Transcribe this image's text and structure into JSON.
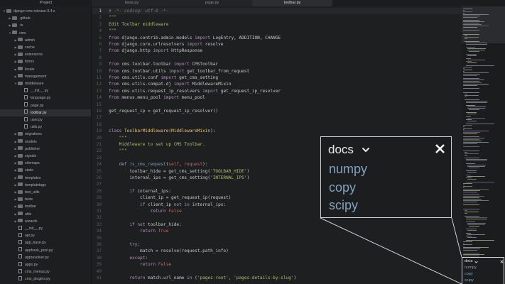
{
  "tabs": {
    "project": "Project",
    "items": [
      "base.py",
      "page.py",
      "toolbar.py"
    ]
  },
  "sidebar": {
    "rows": [
      {
        "label": "django-cms-release-3.4.x",
        "kind": "folder",
        "open": true,
        "depth": 0
      },
      {
        "label": ".github",
        "kind": "folder",
        "open": false,
        "depth": 1
      },
      {
        "label": ".tx",
        "kind": "folder",
        "open": false,
        "depth": 1
      },
      {
        "label": "cms",
        "kind": "folder",
        "open": true,
        "depth": 1
      },
      {
        "label": "admin",
        "kind": "folder",
        "open": false,
        "depth": 2
      },
      {
        "label": "cache",
        "kind": "folder",
        "open": false,
        "depth": 2
      },
      {
        "label": "extensions",
        "kind": "folder",
        "open": false,
        "depth": 2
      },
      {
        "label": "forms",
        "kind": "folder",
        "open": false,
        "depth": 2
      },
      {
        "label": "locale",
        "kind": "folder",
        "open": false,
        "depth": 2
      },
      {
        "label": "management",
        "kind": "folder",
        "open": false,
        "depth": 2
      },
      {
        "label": "middleware",
        "kind": "folder",
        "open": true,
        "depth": 2
      },
      {
        "label": "__init__.py",
        "kind": "file",
        "depth": 3
      },
      {
        "label": "language.py",
        "kind": "file",
        "depth": 3
      },
      {
        "label": "page.py",
        "kind": "file",
        "depth": 3
      },
      {
        "label": "toolbar.py",
        "kind": "file",
        "depth": 3,
        "active": true
      },
      {
        "label": "user.py",
        "kind": "file",
        "depth": 3
      },
      {
        "label": "utils.py",
        "kind": "file",
        "depth": 3
      },
      {
        "label": "migrations",
        "kind": "folder",
        "open": false,
        "depth": 2
      },
      {
        "label": "models",
        "kind": "folder",
        "open": false,
        "depth": 2
      },
      {
        "label": "publisher",
        "kind": "folder",
        "open": false,
        "depth": 2
      },
      {
        "label": "signals",
        "kind": "folder",
        "open": false,
        "depth": 2
      },
      {
        "label": "sitemaps",
        "kind": "folder",
        "open": false,
        "depth": 2
      },
      {
        "label": "static",
        "kind": "folder",
        "open": false,
        "depth": 2
      },
      {
        "label": "templates",
        "kind": "folder",
        "open": false,
        "depth": 2
      },
      {
        "label": "templatetags",
        "kind": "folder",
        "open": false,
        "depth": 2
      },
      {
        "label": "test_utils",
        "kind": "folder",
        "open": false,
        "depth": 2
      },
      {
        "label": "tests",
        "kind": "folder",
        "open": false,
        "depth": 2
      },
      {
        "label": "toolbar",
        "kind": "folder",
        "open": false,
        "depth": 2
      },
      {
        "label": "utils",
        "kind": "folder",
        "open": false,
        "depth": 2
      },
      {
        "label": "wizards",
        "kind": "folder",
        "open": false,
        "depth": 2
      },
      {
        "label": "__init__.py",
        "kind": "file",
        "depth": 2
      },
      {
        "label": "api.py",
        "kind": "file",
        "depth": 2
      },
      {
        "label": "app_base.py",
        "kind": "file",
        "depth": 2
      },
      {
        "label": "apphook_pool.py",
        "kind": "file",
        "depth": 2
      },
      {
        "label": "appresolver.py",
        "kind": "file",
        "depth": 2
      },
      {
        "label": "apps.py",
        "kind": "file",
        "depth": 2
      },
      {
        "label": "cms_menus.py",
        "kind": "file",
        "depth": 2
      },
      {
        "label": "cms_plugins.py",
        "kind": "file",
        "depth": 2
      }
    ]
  },
  "editor": {
    "current_line": 1,
    "lines": [
      [
        [
          "com",
          "# -*- coding: utf-8 -*-"
        ]
      ],
      [
        [
          "str",
          "\"\"\""
        ]
      ],
      [
        [
          "str",
          "Edit Toolbar middleware"
        ]
      ],
      [
        [
          "str",
          "\"\"\""
        ]
      ],
      [
        [
          "kw",
          "from"
        ],
        [
          "pl",
          " django.contrib.admin.models "
        ],
        [
          "kw",
          "import"
        ],
        [
          "pl",
          " LogEntry, ADDITION, CHANGE"
        ]
      ],
      [
        [
          "kw",
          "from"
        ],
        [
          "pl",
          " django.core.urlresolvers "
        ],
        [
          "kw",
          "import"
        ],
        [
          "pl",
          " resolve"
        ]
      ],
      [
        [
          "kw",
          "from"
        ],
        [
          "pl",
          " django.http "
        ],
        [
          "kw",
          "import"
        ],
        [
          "pl",
          " HttpResponse"
        ]
      ],
      [],
      [
        [
          "kw",
          "from"
        ],
        [
          "pl",
          " cms.toolbar.toolbar "
        ],
        [
          "kw",
          "import"
        ],
        [
          "pl",
          " CMSToolbar"
        ]
      ],
      [
        [
          "kw",
          "from"
        ],
        [
          "pl",
          " cms.toolbar.utils "
        ],
        [
          "kw",
          "import"
        ],
        [
          "pl",
          " get_toolbar_from_request"
        ]
      ],
      [
        [
          "kw",
          "from"
        ],
        [
          "pl",
          " cms.utils.conf "
        ],
        [
          "kw",
          "import"
        ],
        [
          "pl",
          " get_cms_setting"
        ]
      ],
      [
        [
          "kw",
          "from"
        ],
        [
          "pl",
          " cms.utils.compat.dj "
        ],
        [
          "kw",
          "import"
        ],
        [
          "pl",
          " MiddlewareMixin"
        ]
      ],
      [
        [
          "kw",
          "from"
        ],
        [
          "pl",
          " cms.utils.request_ip_resolvers "
        ],
        [
          "kw",
          "import"
        ],
        [
          "pl",
          " get_request_ip_resolver"
        ]
      ],
      [
        [
          "kw",
          "from"
        ],
        [
          "pl",
          " menus.menu_pool "
        ],
        [
          "kw",
          "import"
        ],
        [
          "pl",
          " menu_pool"
        ]
      ],
      [],
      [
        [
          "pl",
          "get_request_ip = get_request_ip_resolver()"
        ]
      ],
      [],
      [],
      [
        [
          "kw",
          "class"
        ],
        [
          "pl",
          " "
        ],
        [
          "cls",
          "ToolbarMiddleware"
        ],
        [
          "pl",
          "("
        ],
        [
          "cls",
          "MiddlewareMixin"
        ],
        [
          "pl",
          "):"
        ]
      ],
      [
        [
          "str",
          "    \"\"\""
        ]
      ],
      [
        [
          "str",
          "    Middleware to set up CMS Toolbar."
        ]
      ],
      [
        [
          "str",
          "    \"\"\""
        ]
      ],
      [],
      [
        [
          "kw",
          "    def"
        ],
        [
          "pl",
          " "
        ],
        [
          "fn",
          "is_cms_request"
        ],
        [
          "pl",
          "("
        ],
        [
          "kw2",
          "self"
        ],
        [
          "pl",
          ", "
        ],
        [
          "kw2",
          "request"
        ],
        [
          "pl",
          "):"
        ]
      ],
      [
        [
          "pl",
          "        toolbar_hide = get_cms_setting("
        ],
        [
          "str",
          "'TOOLBAR_HIDE'"
        ],
        [
          "pl",
          ")"
        ]
      ],
      [
        [
          "pl",
          "        internal_ips = get_cms_setting("
        ],
        [
          "str",
          "'INTERNAL_IPS'"
        ],
        [
          "pl",
          ")"
        ]
      ],
      [],
      [
        [
          "kw",
          "        if"
        ],
        [
          "pl",
          " internal_ips:"
        ]
      ],
      [
        [
          "pl",
          "            client_ip = get_request_ip(request)"
        ]
      ],
      [
        [
          "kw",
          "            if"
        ],
        [
          "pl",
          " client_ip "
        ],
        [
          "kw",
          "not in"
        ],
        [
          "pl",
          " internal_ips:"
        ]
      ],
      [
        [
          "kw",
          "                return"
        ],
        [
          "pl",
          " "
        ],
        [
          "kw2",
          "False"
        ]
      ],
      [],
      [
        [
          "kw",
          "        if not"
        ],
        [
          "pl",
          " toolbar_hide:"
        ]
      ],
      [
        [
          "kw",
          "            return"
        ],
        [
          "pl",
          " "
        ],
        [
          "kw2",
          "True"
        ]
      ],
      [],
      [
        [
          "kw",
          "        try"
        ],
        [
          "pl",
          ":"
        ]
      ],
      [
        [
          "pl",
          "            match = resolve(request.path_info)"
        ]
      ],
      [
        [
          "kw",
          "        except"
        ],
        [
          "pl",
          ":"
        ]
      ],
      [
        [
          "kw",
          "            return"
        ],
        [
          "pl",
          " "
        ],
        [
          "kw2",
          "False"
        ]
      ],
      [],
      [
        [
          "kw",
          "        return"
        ],
        [
          "pl",
          " match.url_name "
        ],
        [
          "kw",
          "in"
        ],
        [
          "pl",
          " ("
        ],
        [
          "str",
          "'pages-root'"
        ],
        [
          "pl",
          ", "
        ],
        [
          "str",
          "'pages-details-by-slug'"
        ],
        [
          "pl",
          ")"
        ]
      ]
    ]
  },
  "popup": {
    "title": "docs",
    "items": [
      "numpy",
      "copy",
      "scipy"
    ]
  },
  "mini_popup": {
    "title": "docs",
    "items": [
      "numpy",
      "copy",
      "scipy"
    ]
  },
  "colors": {
    "background": "#1d1f21",
    "keyword": "#b294bb",
    "string": "#b5bd68",
    "function": "#81a2be",
    "class": "#f0c674",
    "comment": "#707880",
    "link": "#81a2be"
  },
  "icons": {
    "folder": "folder-icon",
    "file": "file-icon",
    "close": "close-icon",
    "chevron": "chevron-down-icon"
  }
}
